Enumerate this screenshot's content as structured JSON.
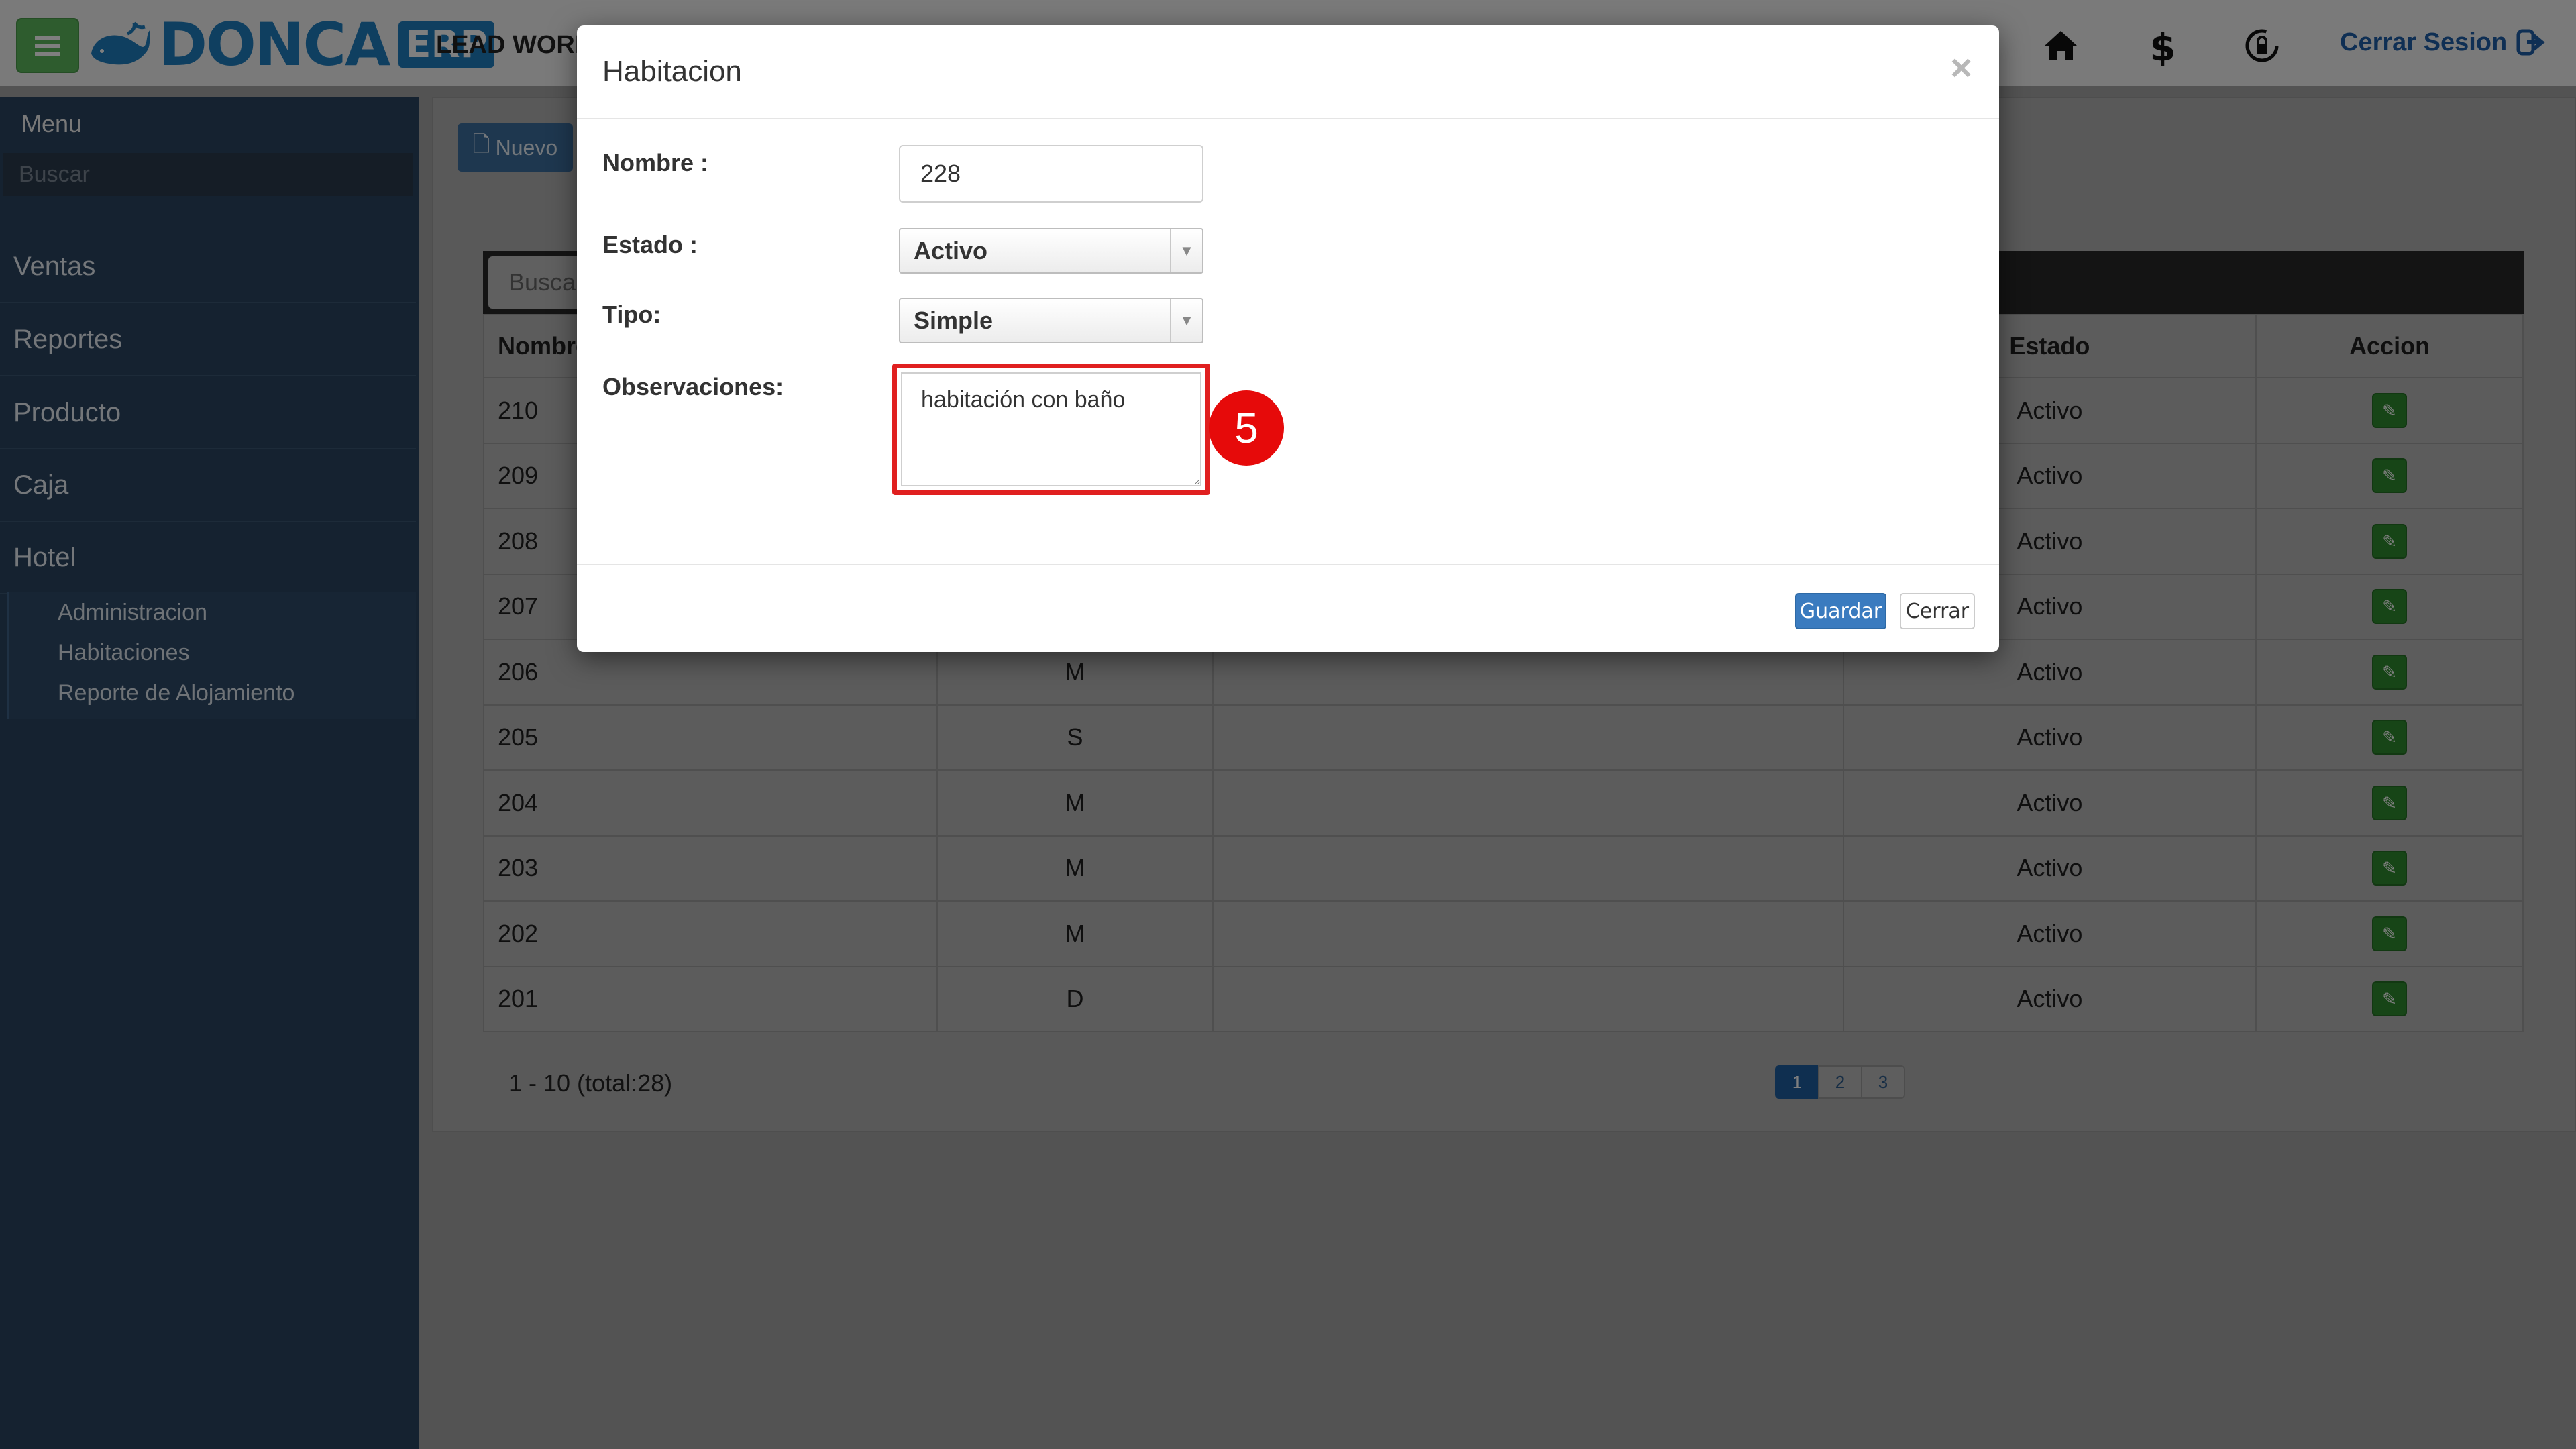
{
  "app": {
    "logo_text": "DONCA",
    "logo_badge": "ERP",
    "company": "LEAD WORK",
    "logout_label": "Cerrar Sesion",
    "icons": [
      "home-icon",
      "dollar-icon",
      "lock-refresh-icon",
      "logout-icon"
    ]
  },
  "sidebar": {
    "menu_title": "Menu",
    "search_placeholder": "Buscar",
    "items": [
      {
        "label": "Ventas"
      },
      {
        "label": "Reportes"
      },
      {
        "label": "Producto"
      },
      {
        "label": "Caja"
      },
      {
        "label": "Hotel"
      }
    ],
    "subitems": [
      {
        "label": "Administracion"
      },
      {
        "label": "Habitaciones"
      },
      {
        "label": "Reporte de Alojamiento"
      }
    ]
  },
  "main": {
    "new_button": "Nuevo",
    "search_placeholder": "Busca",
    "columns": [
      "Nombre",
      "",
      "",
      "Estado",
      "Accion"
    ],
    "rows": [
      {
        "name": "210",
        "tipo": "",
        "obs": "",
        "estado": "Activo"
      },
      {
        "name": "209",
        "tipo": "",
        "obs": "",
        "estado": "Activo"
      },
      {
        "name": "208",
        "tipo": "",
        "obs": "",
        "estado": "Activo"
      },
      {
        "name": "207",
        "tipo": "",
        "obs": "",
        "estado": "Activo"
      },
      {
        "name": "206",
        "tipo": "M",
        "obs": "",
        "estado": "Activo"
      },
      {
        "name": "205",
        "tipo": "S",
        "obs": "",
        "estado": "Activo"
      },
      {
        "name": "204",
        "tipo": "M",
        "obs": "",
        "estado": "Activo"
      },
      {
        "name": "203",
        "tipo": "M",
        "obs": "",
        "estado": "Activo"
      },
      {
        "name": "202",
        "tipo": "M",
        "obs": "",
        "estado": "Activo"
      },
      {
        "name": "201",
        "tipo": "D",
        "obs": "",
        "estado": "Activo"
      }
    ],
    "pagination_text": "1 - 10 (total:28)",
    "pages": [
      "1",
      "2",
      "3"
    ],
    "active_page": "1"
  },
  "modal": {
    "title": "Habitacion",
    "close_symbol": "×",
    "fields": {
      "nombre_label": "Nombre :",
      "nombre_value": "228",
      "estado_label": "Estado :",
      "estado_value": "Activo",
      "tipo_label": "Tipo:",
      "tipo_value": "Simple",
      "observaciones_label": "Observaciones:",
      "observaciones_value": "habitación con baño"
    },
    "save_label": "Guardar",
    "close_label": "Cerrar"
  },
  "annotation": {
    "step_number": "5",
    "highlight_color": "#e02020"
  },
  "colors": {
    "accent": "#3a7bbf",
    "success": "#5cb85c",
    "sidebar": "#2b4460"
  }
}
